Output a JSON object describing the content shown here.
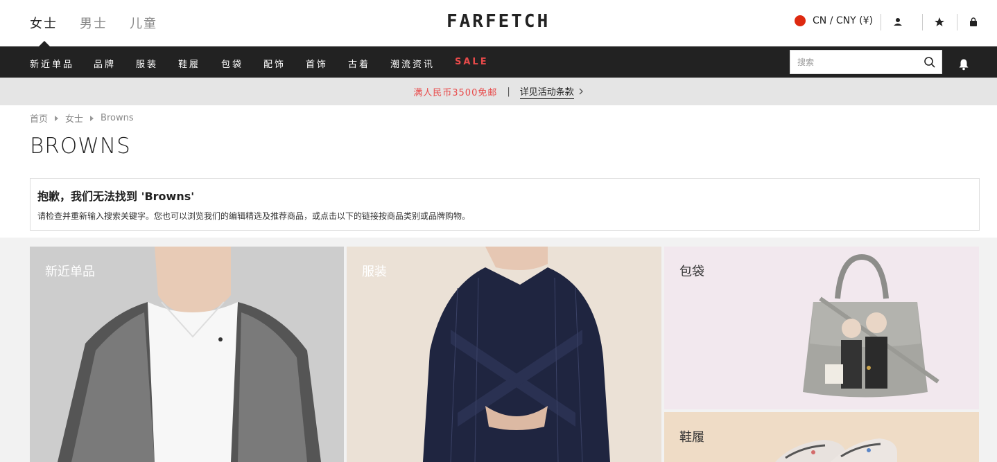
{
  "header": {
    "genders": [
      "女士",
      "男士",
      "儿童"
    ],
    "logo": "FARFETCH",
    "region": "CN / CNY (¥)"
  },
  "nav": {
    "items": [
      "新近单品",
      "品牌",
      "服装",
      "鞋履",
      "包袋",
      "配饰",
      "首饰",
      "古着",
      "潮流资讯",
      "SALE"
    ],
    "search_placeholder": "搜索"
  },
  "promo": {
    "text": "满人民币3500免邮",
    "separator": "|",
    "link": "详见活动条款"
  },
  "breadcrumb": [
    "首页",
    "女士",
    "Browns"
  ],
  "page_title": "BROWNS",
  "notice": {
    "heading": "抱歉，我们无法找到 'Browns'",
    "body": "请检查并重新输入搜索关键字。您也可以浏览我们的编辑精选及推荐商品，或点击以下的链接按商品类别或品牌购物。"
  },
  "tiles": [
    {
      "label": "新近单品"
    },
    {
      "label": "服装"
    },
    {
      "label": "包袋"
    },
    {
      "label": "鞋履"
    }
  ],
  "colors": {
    "nav_bg": "#222222",
    "sale": "#e84a4a",
    "promo_bg": "#e5e5e5"
  }
}
